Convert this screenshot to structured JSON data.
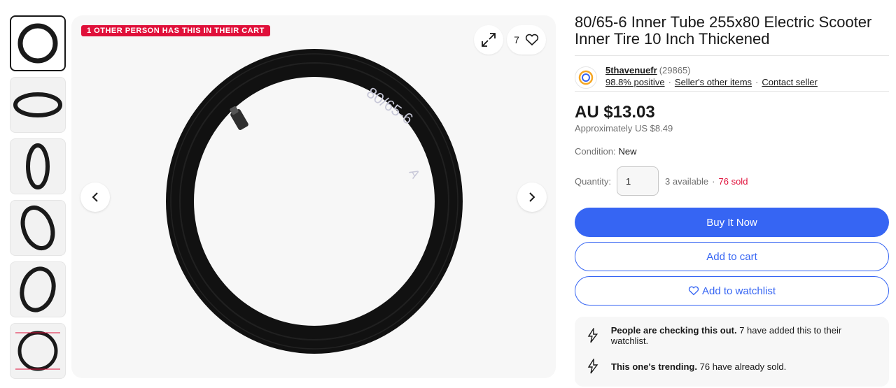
{
  "product": {
    "title": "80/65-6 Inner Tube 255x80 Electric Scooter Inner Tire 10 Inch Thickened"
  },
  "gallery": {
    "cart_badge": "1 OTHER PERSON HAS THIS IN THEIR CART",
    "watch_count": "7",
    "tube_print": "80/65-6",
    "tube_print_tail": "A"
  },
  "seller": {
    "name": "5thavenuefr",
    "count": "(29865)",
    "positive": "98.8% positive",
    "other_items": "Seller's other items",
    "contact": "Contact seller"
  },
  "pricing": {
    "price": "AU $13.03",
    "approx_label": "Approximately",
    "approx_value": "US $8.49"
  },
  "condition": {
    "label": "Condition:",
    "value": "New"
  },
  "quantity": {
    "label": "Quantity:",
    "value": "1",
    "available": "3 available",
    "sold": "76 sold"
  },
  "actions": {
    "buy_now": "Buy It Now",
    "add_cart": "Add to cart",
    "add_watchlist": "Add to watchlist"
  },
  "signals": [
    {
      "bold": "People are checking this out.",
      "rest": "7 have added this to their watchlist."
    },
    {
      "bold": "This one's trending.",
      "rest": "76 have already sold."
    }
  ],
  "colors": {
    "accent": "#3665f3",
    "badge": "#e0103a"
  },
  "icons": [
    "expand-icon",
    "heart-icon",
    "chevron-left-icon",
    "chevron-right-icon",
    "signal-icon"
  ]
}
